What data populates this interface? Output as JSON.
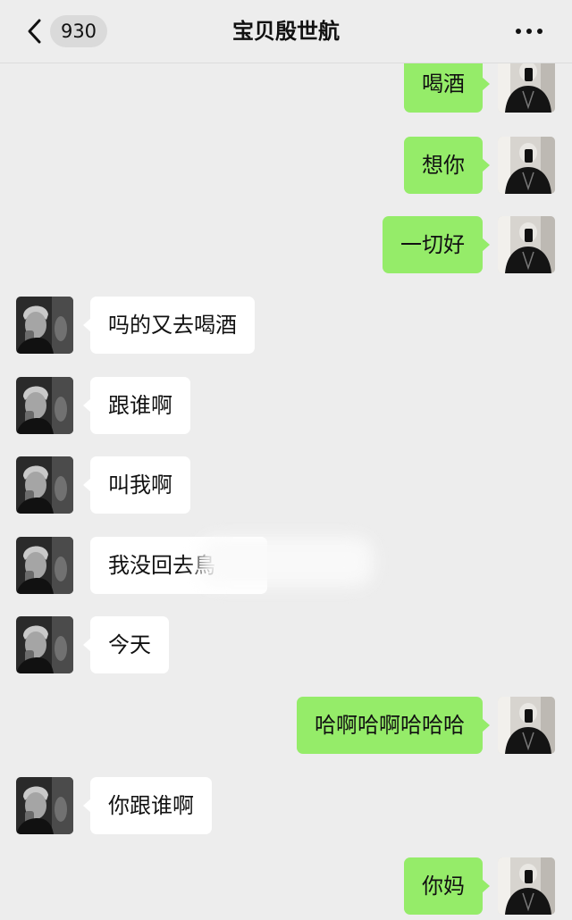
{
  "header": {
    "back_icon": "chevron-left-icon",
    "unread_count": "930",
    "title": "宝贝殷世航",
    "more_icon": "more-dots-icon"
  },
  "messages": [
    {
      "side": "right",
      "text": "喝酒"
    },
    {
      "side": "right",
      "text": "想你"
    },
    {
      "side": "right",
      "text": "一切好"
    },
    {
      "side": "left",
      "text": "吗的又去喝酒"
    },
    {
      "side": "left",
      "text": "跟谁啊"
    },
    {
      "side": "left",
      "text": "叫我啊"
    },
    {
      "side": "left",
      "text": "我没回去鳥"
    },
    {
      "side": "left",
      "text": "今天"
    },
    {
      "side": "right",
      "text": "哈啊哈啊哈哈哈"
    },
    {
      "side": "left",
      "text": "你跟谁啊"
    },
    {
      "side": "right",
      "text": "你妈"
    }
  ],
  "colors": {
    "background": "#ededed",
    "sent_bubble": "#95ec69",
    "received_bubble": "#ffffff"
  }
}
